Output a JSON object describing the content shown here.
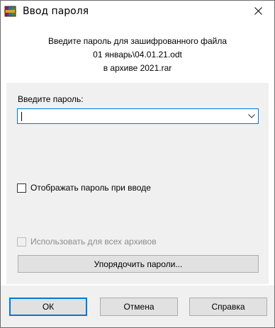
{
  "window": {
    "title": "Ввод пароля"
  },
  "info": {
    "line1": "Введите пароль для зашифрованного файла",
    "line2": "01 январь\\04.01.21.odt",
    "line3": "в архиве 2021.rar"
  },
  "password": {
    "label": "Введите пароль:",
    "value": ""
  },
  "options": {
    "show_password": "Отображать пароль при вводе",
    "show_password_checked": false,
    "use_for_all": "Использовать для всех архивов",
    "use_for_all_checked": false,
    "use_for_all_enabled": false
  },
  "organize_button": "Упорядочить пароли...",
  "footer": {
    "ok": "ОК",
    "cancel": "Отмена",
    "help": "Справка"
  },
  "colors": {
    "focus": "#0078d7",
    "button_face": "#e1e1e1",
    "dialog_bg": "#f0f0f0"
  },
  "icons": {
    "app": "winrar-books-icon",
    "close": "close-icon",
    "dropdown": "chevron-down-icon"
  }
}
